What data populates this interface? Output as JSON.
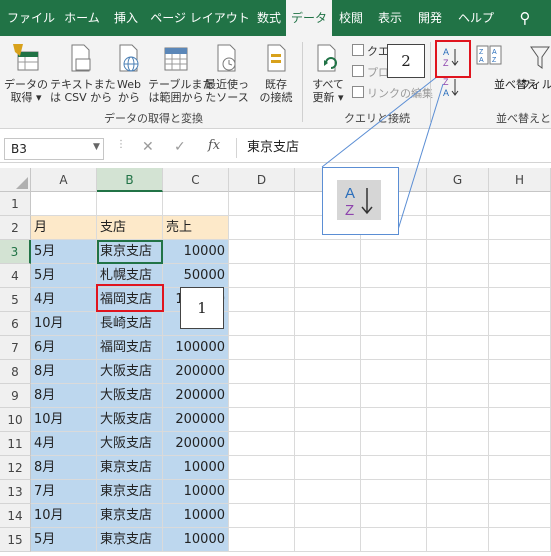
{
  "tabs": [
    {
      "label": "ファイル",
      "active": false
    },
    {
      "label": "ホーム",
      "active": false
    },
    {
      "label": "挿入",
      "active": false
    },
    {
      "label": "ページ レイアウト",
      "active": false
    },
    {
      "label": "数式",
      "active": false
    },
    {
      "label": "データ",
      "active": true
    },
    {
      "label": "校閲",
      "active": false
    },
    {
      "label": "表示",
      "active": false
    },
    {
      "label": "開発",
      "active": false
    },
    {
      "label": "ヘルプ",
      "active": false
    }
  ],
  "ribbon": {
    "get_data": {
      "line1": "データの",
      "line2": "取得 ▾"
    },
    "from_text_csv": {
      "line1": "テキストまた",
      "line2": "は CSV から"
    },
    "from_web": {
      "line1": "Web",
      "line2": "から"
    },
    "from_table": {
      "line1": "テーブルまた",
      "line2": "は範囲から"
    },
    "recent_sources": {
      "line1": "最近使っ",
      "line2": "たソース"
    },
    "existing_conn": {
      "line1": "既存",
      "line2": "の接続"
    },
    "group_get_data": "データの取得と変換",
    "refresh_all": {
      "line1": "すべて",
      "line2": "更新 ▾"
    },
    "queries": "クエ",
    "properties": "プロ",
    "edit_links": "リンクの編集",
    "group_queries": "クエリと接続",
    "sort_label": "並べ替え",
    "filter_label": "フィル",
    "group_sort": "並べ替えと"
  },
  "formula_bar": {
    "name_box": "B3",
    "formula": "東京支店"
  },
  "columns": [
    "A",
    "B",
    "C",
    "D",
    "E",
    "F",
    "G",
    "H"
  ],
  "selected_column": "B",
  "selected_row": "3",
  "rows": [
    {
      "num": "1",
      "a": "",
      "b": "",
      "c": ""
    },
    {
      "num": "2",
      "a": "月",
      "b": "支店",
      "c": "売上"
    },
    {
      "num": "3",
      "a": "5月",
      "b": "東京支店",
      "c": "10000"
    },
    {
      "num": "4",
      "a": "5月",
      "b": "札幌支店",
      "c": "50000"
    },
    {
      "num": "5",
      "a": "4月",
      "b": "福岡支店",
      "c": "100000"
    },
    {
      "num": "6",
      "a": "10月",
      "b": "長崎支店",
      "c": ""
    },
    {
      "num": "7",
      "a": "6月",
      "b": "福岡支店",
      "c": "100000"
    },
    {
      "num": "8",
      "a": "8月",
      "b": "大阪支店",
      "c": "200000"
    },
    {
      "num": "9",
      "a": "8月",
      "b": "大阪支店",
      "c": "200000"
    },
    {
      "num": "10",
      "a": "10月",
      "b": "大阪支店",
      "c": "200000"
    },
    {
      "num": "11",
      "a": "4月",
      "b": "大阪支店",
      "c": "200000"
    },
    {
      "num": "12",
      "a": "8月",
      "b": "東京支店",
      "c": "10000"
    },
    {
      "num": "13",
      "a": "7月",
      "b": "東京支店",
      "c": "10000"
    },
    {
      "num": "14",
      "a": "10月",
      "b": "東京支店",
      "c": "10000"
    },
    {
      "num": "15",
      "a": "5月",
      "b": "東京支店",
      "c": "10000"
    }
  ],
  "callouts": {
    "step1": "1",
    "step2": "2"
  },
  "colors": {
    "ribbon_green": "#217346",
    "header_fill": "#fde9c9",
    "selection_fill": "#bdd7ee",
    "callout_red": "#e0141e"
  }
}
